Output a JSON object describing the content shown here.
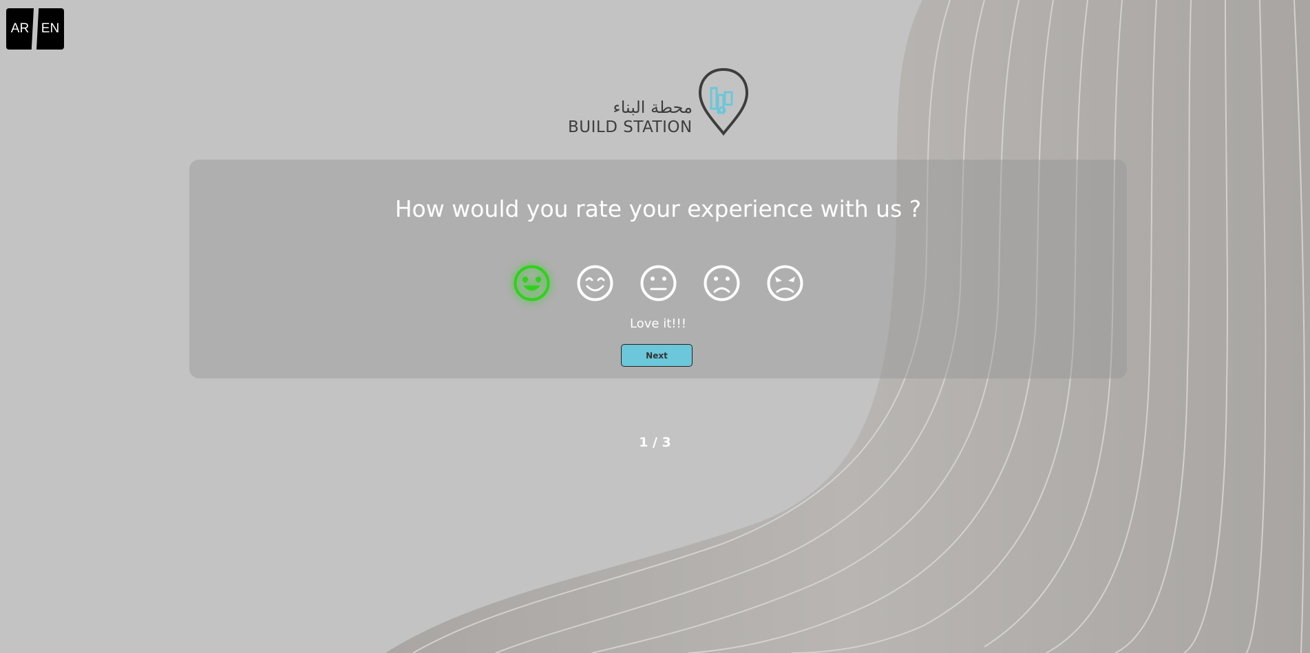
{
  "language_switch": {
    "ar_label": "AR",
    "en_label": "EN"
  },
  "logo": {
    "arabic_text": "محطة البناء",
    "english_text": "BUILD STATION"
  },
  "survey": {
    "question": "How would you rate your experience with us ?",
    "rating_options": [
      {
        "icon": "love-face-icon",
        "selected": true
      },
      {
        "icon": "smile-face-icon",
        "selected": false
      },
      {
        "icon": "neutral-face-icon",
        "selected": false
      },
      {
        "icon": "sad-face-icon",
        "selected": false
      },
      {
        "icon": "angry-face-icon",
        "selected": false
      }
    ],
    "selected_label": "Love it!!!",
    "next_label": "Next"
  },
  "progress": {
    "text": "1 / 3"
  },
  "colors": {
    "selected_face": "#2dd21a",
    "next_button": "#6bc7d9",
    "logo_accent": "#6bc7d9"
  }
}
